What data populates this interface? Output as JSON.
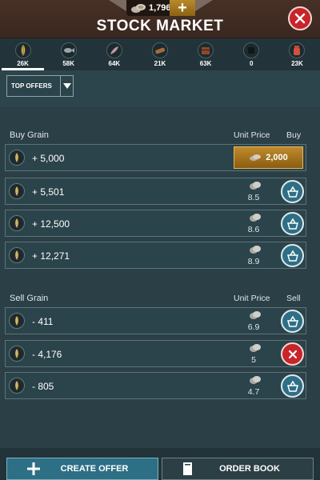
{
  "header": {
    "title": "STOCK MARKET",
    "gold_amount": "1,796"
  },
  "resources": [
    {
      "name": "grain",
      "value": "26K",
      "active": true
    },
    {
      "name": "fish",
      "value": "58K",
      "active": false
    },
    {
      "name": "feather",
      "value": "64K",
      "active": false
    },
    {
      "name": "wood",
      "value": "21K",
      "active": false
    },
    {
      "name": "chest",
      "value": "63K",
      "active": false
    },
    {
      "name": "unknown-dark",
      "value": "0",
      "active": false
    },
    {
      "name": "jar",
      "value": "23K",
      "active": false
    }
  ],
  "filter": {
    "selected": "TOP OFFERS"
  },
  "buy_section": {
    "title": "Buy Grain",
    "price_header": "Unit Price",
    "action_header": "Buy",
    "rows": [
      {
        "qty": "+ 5,000",
        "price": "2,000",
        "kind": "gold"
      },
      {
        "qty": "+ 5,501",
        "price": "8.5",
        "kind": "buy"
      },
      {
        "qty": "+ 12,500",
        "price": "8.6",
        "kind": "buy"
      },
      {
        "qty": "+ 12,271",
        "price": "8.9",
        "kind": "buy"
      }
    ]
  },
  "sell_section": {
    "title": "Sell Grain",
    "price_header": "Unit Price",
    "action_header": "Sell",
    "rows": [
      {
        "qty": "- 411",
        "price": "6.9",
        "kind": "sell"
      },
      {
        "qty": "- 4,176",
        "price": "5",
        "kind": "cancel"
      },
      {
        "qty": "- 805",
        "price": "4.7",
        "kind": "sell"
      }
    ]
  },
  "footer": {
    "create_label": "CREATE OFFER",
    "order_label": "ORDER BOOK"
  },
  "colors": {
    "header_bg": "#3a2820",
    "panel_bg": "#2b434a",
    "gold": "#c08a2c",
    "action_blue": "#2e6f86",
    "cancel_red": "#c8242b"
  }
}
